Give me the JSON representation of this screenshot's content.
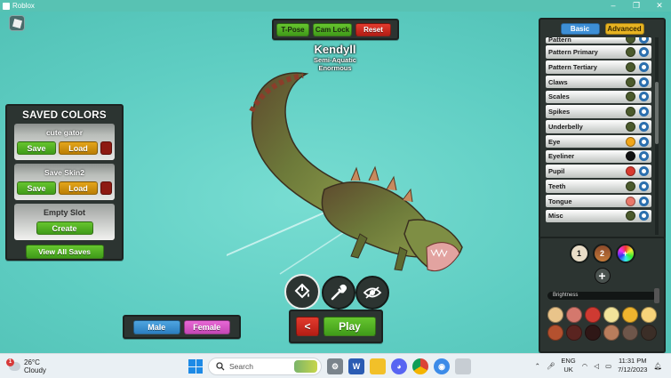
{
  "window": {
    "title": "Roblox",
    "controls": [
      "–",
      "❐",
      "✕"
    ]
  },
  "top_tools": [
    {
      "id": "tpose",
      "label": "T-Pose",
      "color": "#6cc52b"
    },
    {
      "id": "camlock",
      "label": "Cam Lock",
      "color": "#6cc52b"
    },
    {
      "id": "reset",
      "label": "Reset",
      "color": "#d93025"
    }
  ],
  "character": {
    "name": "Kendyll",
    "tags": [
      "Semi-Aquatic",
      "Enormous"
    ]
  },
  "saved_colors": {
    "title": "SAVED COLORS",
    "slots": [
      {
        "name": "cute gator",
        "save": "Save",
        "load": "Load"
      },
      {
        "name": "Save Skin2",
        "save": "Save",
        "load": "Load"
      }
    ],
    "empty_slot": {
      "name": "Empty Slot",
      "create": "Create"
    },
    "view_all": "View All Saves"
  },
  "gender": {
    "male": "Male",
    "female": "Female",
    "selected": "Female"
  },
  "tools": [
    {
      "icon": "paint-bucket-icon"
    },
    {
      "icon": "eyedropper-icon"
    },
    {
      "icon": "eye-slash-icon"
    }
  ],
  "playbar": {
    "back": "<",
    "play": "Play"
  },
  "right_panel": {
    "tabs": {
      "basic": "Basic",
      "advanced": "Advanced",
      "active": "Basic"
    },
    "parts": [
      {
        "label": "Pattern",
        "color": "#4b5a2c"
      },
      {
        "label": "Pattern Primary",
        "color": "#4b5a2c"
      },
      {
        "label": "Pattern Tertiary",
        "color": "#4b5a2c"
      },
      {
        "label": "Claws",
        "color": "#4b5a2c"
      },
      {
        "label": "Scales",
        "color": "#4b5a2c"
      },
      {
        "label": "Spikes",
        "color": "#4b5a2c"
      },
      {
        "label": "Underbelly",
        "color": "#4b5a2c"
      },
      {
        "label": "Eye",
        "color": "#f1a619"
      },
      {
        "label": "Eyeliner",
        "color": "#111111"
      },
      {
        "label": "Pupil",
        "color": "#d93a2f"
      },
      {
        "label": "Teeth",
        "color": "#4b5a2c"
      },
      {
        "label": "Tongue",
        "color": "#e9786a"
      },
      {
        "label": "Misc",
        "color": "#4b5a2c"
      }
    ]
  },
  "palette": {
    "pages": [
      "1",
      "2",
      "+"
    ],
    "add": "+",
    "brightness_label": "Brightness",
    "swatches": [
      "#e9c48a",
      "#d4786d",
      "#cf3a32",
      "#f2e49a",
      "#eeb42e",
      "#f6d37a",
      "#b4512f",
      "#5a2420",
      "#2f1716",
      "#b97d5c",
      "#6e564a",
      "#3b2e27"
    ]
  },
  "taskbar": {
    "weather": {
      "badge": "1",
      "temp": "26°C",
      "desc": "Cloudy"
    },
    "search_placeholder": "Search",
    "lang": [
      "ENG",
      "UK"
    ],
    "time": "11:31 PM",
    "date": "7/12/2023"
  }
}
